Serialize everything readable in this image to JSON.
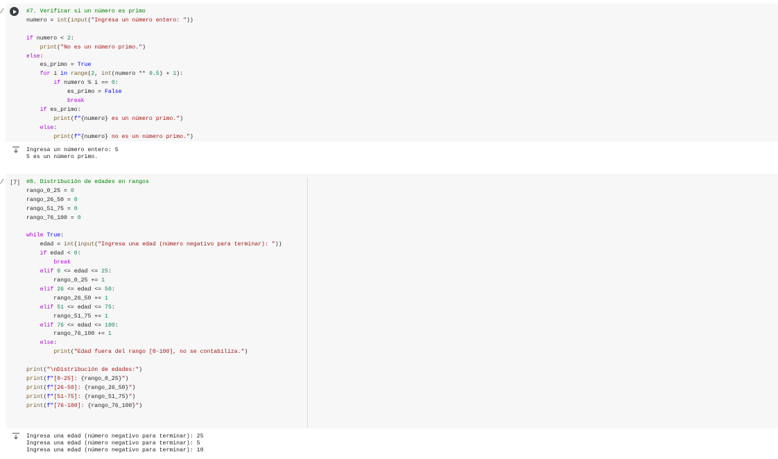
{
  "cells": [
    {
      "execution_count": "",
      "lines": [
        [
          [
            "#7. Verificar si un número es primo",
            "cm"
          ]
        ],
        [
          [
            "numero = ",
            ""
          ],
          [
            "int",
            "bi"
          ],
          [
            "(",
            ""
          ],
          [
            "input",
            "bi"
          ],
          [
            "(",
            ""
          ],
          [
            "\"Ingresa un número entero: \"",
            "str"
          ],
          [
            "))",
            ""
          ]
        ],
        [
          [
            "",
            ""
          ]
        ],
        [
          [
            "if",
            "kw2"
          ],
          [
            " numero < ",
            ""
          ],
          [
            "2",
            "num"
          ],
          [
            ":",
            ""
          ]
        ],
        [
          [
            "    ",
            ""
          ],
          [
            "print",
            "bi"
          ],
          [
            "(",
            ""
          ],
          [
            "\"No es un número primo.\"",
            "str"
          ],
          [
            ")",
            ""
          ]
        ],
        [
          [
            "else",
            "kw2"
          ],
          [
            ":",
            ""
          ]
        ],
        [
          [
            "    es_primo = ",
            ""
          ],
          [
            "True",
            "kw"
          ]
        ],
        [
          [
            "    ",
            ""
          ],
          [
            "for",
            "kw2"
          ],
          [
            " i ",
            ""
          ],
          [
            "in",
            "kw"
          ],
          [
            " ",
            ""
          ],
          [
            "range",
            "bi"
          ],
          [
            "(",
            ""
          ],
          [
            "2",
            "num"
          ],
          [
            ", ",
            ""
          ],
          [
            "int",
            "bi"
          ],
          [
            "(numero ** ",
            ""
          ],
          [
            "0.5",
            "num"
          ],
          [
            ") + ",
            ""
          ],
          [
            "1",
            "num"
          ],
          [
            "):",
            ""
          ]
        ],
        [
          [
            "        ",
            ""
          ],
          [
            "if",
            "kw2"
          ],
          [
            " numero % i == ",
            ""
          ],
          [
            "0",
            "num"
          ],
          [
            ":",
            ""
          ]
        ],
        [
          [
            "            es_primo = ",
            ""
          ],
          [
            "False",
            "kw"
          ]
        ],
        [
          [
            "            ",
            ""
          ],
          [
            "break",
            "kw2"
          ]
        ],
        [
          [
            "    ",
            ""
          ],
          [
            "if",
            "kw2"
          ],
          [
            " es_primo:",
            ""
          ]
        ],
        [
          [
            "        ",
            ""
          ],
          [
            "print",
            "bi"
          ],
          [
            "(",
            ""
          ],
          [
            "f\"",
            "kw"
          ],
          [
            "{numero}",
            ""
          ],
          [
            " es un número primo.\"",
            "str"
          ],
          [
            ")",
            ""
          ]
        ],
        [
          [
            "    ",
            ""
          ],
          [
            "else",
            "kw2"
          ],
          [
            ":",
            ""
          ]
        ],
        [
          [
            "        ",
            ""
          ],
          [
            "print",
            "bi"
          ],
          [
            "(",
            ""
          ],
          [
            "f\"",
            "kw"
          ],
          [
            "{numero}",
            ""
          ],
          [
            " no es un número primo.\"",
            "str"
          ],
          [
            ")",
            ""
          ]
        ]
      ],
      "output": "Ingresa un número entero: 5\n5 es un número primo."
    },
    {
      "execution_count": "[7]",
      "lines": [
        [
          [
            "#8. Distribución de edades en rangos",
            "cm"
          ]
        ],
        [
          [
            "rango_0_25 = ",
            ""
          ],
          [
            "0",
            "num"
          ]
        ],
        [
          [
            "rango_26_50 = ",
            ""
          ],
          [
            "0",
            "num"
          ]
        ],
        [
          [
            "rango_51_75 = ",
            ""
          ],
          [
            "0",
            "num"
          ]
        ],
        [
          [
            "rango_76_100 = ",
            ""
          ],
          [
            "0",
            "num"
          ]
        ],
        [
          [
            "",
            ""
          ]
        ],
        [
          [
            "while",
            "kw2"
          ],
          [
            " ",
            ""
          ],
          [
            "True",
            "kw"
          ],
          [
            ":",
            ""
          ]
        ],
        [
          [
            "    edad = ",
            ""
          ],
          [
            "int",
            "bi"
          ],
          [
            "(",
            ""
          ],
          [
            "input",
            "bi"
          ],
          [
            "(",
            ""
          ],
          [
            "\"Ingresa una edad (número negativo para terminar): \"",
            "str"
          ],
          [
            "))",
            ""
          ]
        ],
        [
          [
            "    ",
            ""
          ],
          [
            "if",
            "kw2"
          ],
          [
            " edad < ",
            ""
          ],
          [
            "0",
            "num"
          ],
          [
            ":",
            ""
          ]
        ],
        [
          [
            "        ",
            ""
          ],
          [
            "break",
            "kw2"
          ]
        ],
        [
          [
            "    ",
            ""
          ],
          [
            "elif",
            "kw2"
          ],
          [
            " ",
            ""
          ],
          [
            "0",
            "num"
          ],
          [
            " <= edad <= ",
            ""
          ],
          [
            "25",
            "num"
          ],
          [
            ":",
            ""
          ]
        ],
        [
          [
            "        rango_0_25 += ",
            ""
          ],
          [
            "1",
            "num"
          ]
        ],
        [
          [
            "    ",
            ""
          ],
          [
            "elif",
            "kw2"
          ],
          [
            " ",
            ""
          ],
          [
            "26",
            "num"
          ],
          [
            " <= edad <= ",
            ""
          ],
          [
            "50",
            "num"
          ],
          [
            ":",
            ""
          ]
        ],
        [
          [
            "        rango_26_50 += ",
            ""
          ],
          [
            "1",
            "num"
          ]
        ],
        [
          [
            "    ",
            ""
          ],
          [
            "elif",
            "kw2"
          ],
          [
            " ",
            ""
          ],
          [
            "51",
            "num"
          ],
          [
            " <= edad <= ",
            ""
          ],
          [
            "75",
            "num"
          ],
          [
            ":",
            ""
          ]
        ],
        [
          [
            "        rango_51_75 += ",
            ""
          ],
          [
            "1",
            "num"
          ]
        ],
        [
          [
            "    ",
            ""
          ],
          [
            "elif",
            "kw2"
          ],
          [
            " ",
            ""
          ],
          [
            "76",
            "num"
          ],
          [
            " <= edad <= ",
            ""
          ],
          [
            "100",
            "num"
          ],
          [
            ":",
            ""
          ]
        ],
        [
          [
            "        rango_76_100 += ",
            ""
          ],
          [
            "1",
            "num"
          ]
        ],
        [
          [
            "    ",
            ""
          ],
          [
            "else",
            "kw2"
          ],
          [
            ":",
            ""
          ]
        ],
        [
          [
            "        ",
            ""
          ],
          [
            "print",
            "bi"
          ],
          [
            "(",
            ""
          ],
          [
            "\"Edad fuera del rango [0-100], no se contabiliza.\"",
            "str"
          ],
          [
            ")",
            ""
          ]
        ],
        [
          [
            "",
            ""
          ]
        ],
        [
          [
            "print",
            "bi"
          ],
          [
            "(",
            ""
          ],
          [
            "\"\\nDistribución de edades:\"",
            "str"
          ],
          [
            ")",
            ""
          ]
        ],
        [
          [
            "print",
            "bi"
          ],
          [
            "(",
            ""
          ],
          [
            "f\"",
            "kw"
          ],
          [
            "[0-25]: ",
            "str"
          ],
          [
            "{rango_0_25}",
            ""
          ],
          [
            "\"",
            "str"
          ],
          [
            ")",
            ""
          ]
        ],
        [
          [
            "print",
            "bi"
          ],
          [
            "(",
            ""
          ],
          [
            "f\"",
            "kw"
          ],
          [
            "[26-50]: ",
            "str"
          ],
          [
            "{rango_26_50}",
            ""
          ],
          [
            "\"",
            "str"
          ],
          [
            ")",
            ""
          ]
        ],
        [
          [
            "print",
            "bi"
          ],
          [
            "(",
            ""
          ],
          [
            "f\"",
            "kw"
          ],
          [
            "[51-75]: ",
            "str"
          ],
          [
            "{rango_51_75}",
            ""
          ],
          [
            "\"",
            "str"
          ],
          [
            ")",
            ""
          ]
        ],
        [
          [
            "print",
            "bi"
          ],
          [
            "(",
            ""
          ],
          [
            "f\"",
            "kw"
          ],
          [
            "[76-100]: ",
            "str"
          ],
          [
            "{rango_76_100}",
            ""
          ],
          [
            "\"",
            "str"
          ],
          [
            ")",
            ""
          ]
        ]
      ],
      "output": "Ingresa una edad (número negativo para terminar): 25\nIngresa una edad (número negativo para terminar): 5\nIngresa una edad (número negativo para terminar): 10"
    }
  ],
  "icons": {
    "run": "play-icon",
    "output": "output-toggle-icon"
  }
}
